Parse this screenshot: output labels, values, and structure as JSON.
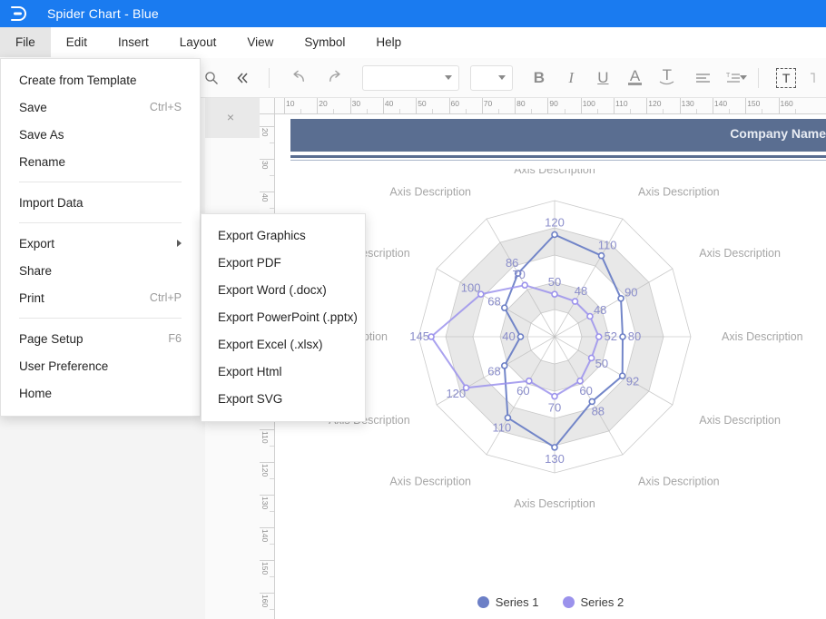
{
  "titlebar": {
    "app_title": "Spider Chart - Blue",
    "logo_icon": "edraw-d-logo-icon"
  },
  "menubar": {
    "items": [
      {
        "label": "File",
        "active": true
      },
      {
        "label": "Edit",
        "active": false
      },
      {
        "label": "Insert",
        "active": false
      },
      {
        "label": "Layout",
        "active": false
      },
      {
        "label": "View",
        "active": false
      },
      {
        "label": "Symbol",
        "active": false
      },
      {
        "label": "Help",
        "active": false
      }
    ]
  },
  "toolbar": {
    "search_icon": "search-icon",
    "collapse_icon": "double-chevron-left-icon",
    "undo_icon": "undo-icon",
    "redo_icon": "redo-icon",
    "font_family_value": "",
    "font_size_value": "",
    "bold_label": "B",
    "italic_label": "I",
    "underline_label": "U",
    "font_color_label": "A",
    "text_effect_label": "T",
    "align_icon": "align-left-icon",
    "line_spacing_icon": "line-spacing-icon",
    "text_box_label": "T"
  },
  "left_panel": {
    "close_label": "×"
  },
  "rulers": {
    "horizontal_labels": [
      "10",
      "20",
      "30",
      "40",
      "50",
      "60",
      "70",
      "80",
      "90",
      "100",
      "110",
      "120",
      "130",
      "140",
      "150",
      "160"
    ],
    "vertical_labels": [
      "20",
      "30",
      "40",
      "110",
      "120",
      "130",
      "140",
      "150",
      "160"
    ]
  },
  "canvas": {
    "banner_text": "Company Name"
  },
  "file_menu": {
    "items": [
      {
        "label": "Create from Template",
        "shortcut": "",
        "submenu": false
      },
      {
        "label": "Save",
        "shortcut": "Ctrl+S",
        "submenu": false
      },
      {
        "label": "Save As",
        "shortcut": "",
        "submenu": false
      },
      {
        "label": "Rename",
        "shortcut": "",
        "submenu": false
      },
      {
        "divider": true
      },
      {
        "label": "Import Data",
        "shortcut": "",
        "submenu": false
      },
      {
        "divider": true
      },
      {
        "label": "Export",
        "shortcut": "",
        "submenu": true
      },
      {
        "label": "Share",
        "shortcut": "",
        "submenu": false
      },
      {
        "label": "Print",
        "shortcut": "Ctrl+P",
        "submenu": false
      },
      {
        "divider": true
      },
      {
        "label": "Page Setup",
        "shortcut": "F6",
        "submenu": false
      },
      {
        "label": "User Preference",
        "shortcut": "",
        "submenu": false
      },
      {
        "label": "Home",
        "shortcut": "",
        "submenu": false
      }
    ]
  },
  "export_menu": {
    "items": [
      {
        "label": "Export Graphics"
      },
      {
        "label": "Export PDF"
      },
      {
        "label": "Export Word (.docx)"
      },
      {
        "label": "Export PowerPoint (.pptx)"
      },
      {
        "label": "Export Excel (.xlsx)"
      },
      {
        "label": "Export Html"
      },
      {
        "label": "Export SVG"
      }
    ]
  },
  "colors": {
    "title_bar": "#1a7bf0",
    "banner": "#5a6e91",
    "series1": "#6c7fc6",
    "series2": "#9b92ec",
    "grid_band": "#e8e8e8",
    "grid_line": "#b9b9b9",
    "axis_label": "#a6a6a6",
    "data_label": "#8b8ecb"
  },
  "chart_data": {
    "type": "radar",
    "title": "",
    "axis_count": 12,
    "categories": [
      "Axis Description",
      "Axis Description",
      "Axis Description",
      "Axis Description",
      "Axis Description",
      "Axis Description",
      "Axis Description",
      "Axis Description",
      "Axis Description",
      "Axis Description",
      "Axis Description",
      "Axis Description"
    ],
    "rmax": 160,
    "rings": 5,
    "grid": true,
    "legend_position": "bottom",
    "series": [
      {
        "name": "Series 1",
        "color": "#6c7fc6",
        "values": [
          120,
          110,
          90,
          80,
          92,
          88,
          130,
          110,
          68,
          40,
          68,
          86
        ]
      },
      {
        "name": "Series 2",
        "color": "#9b92ec",
        "values": [
          50,
          48,
          48,
          52,
          50,
          60,
          70,
          60,
          120,
          145,
          100,
          70
        ]
      }
    ]
  },
  "legend": {
    "items": [
      {
        "label": "Series 1",
        "color": "#6c7fc6"
      },
      {
        "label": "Series 2",
        "color": "#9b92ec"
      }
    ]
  }
}
